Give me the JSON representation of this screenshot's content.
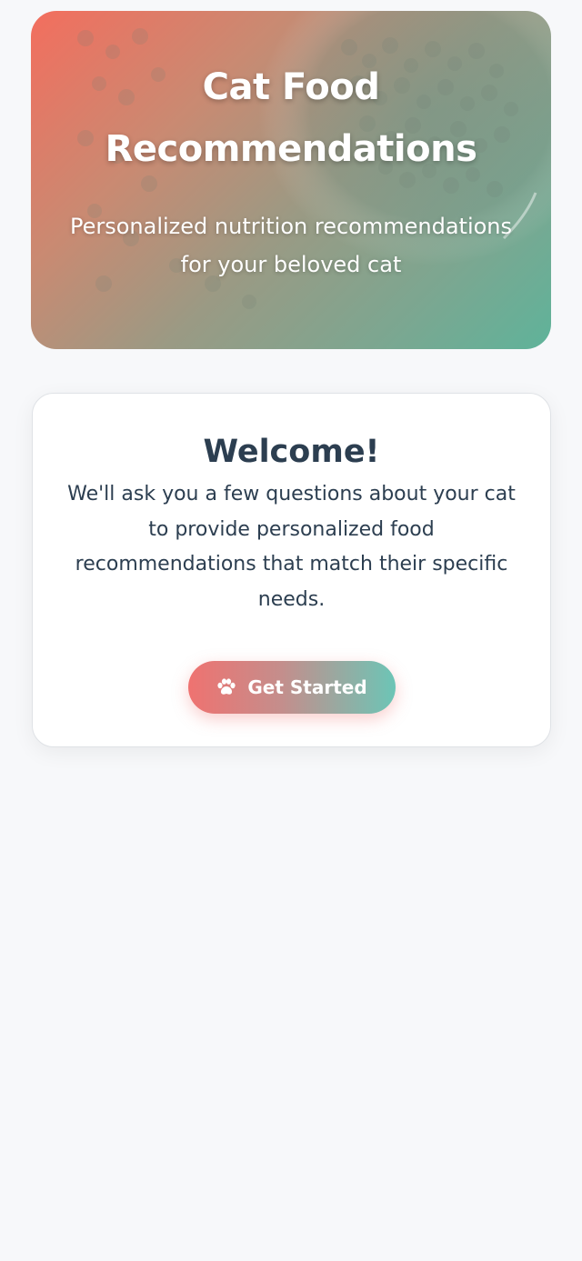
{
  "hero": {
    "title": "Cat Food Recommendations",
    "subtitle": "Personalized nutrition recommendations for your beloved cat"
  },
  "welcome": {
    "title": "Welcome!",
    "text": "We'll ask you a few questions about your cat to provide personalized food recommendations that match their specific needs.",
    "button_label": "Get Started",
    "button_icon": "paw-icon"
  },
  "colors": {
    "page_background": "#f7f8fa",
    "text_dark": "#2c3e50",
    "accent_coral": "#ef7270",
    "accent_teal": "#6cc5b6"
  }
}
